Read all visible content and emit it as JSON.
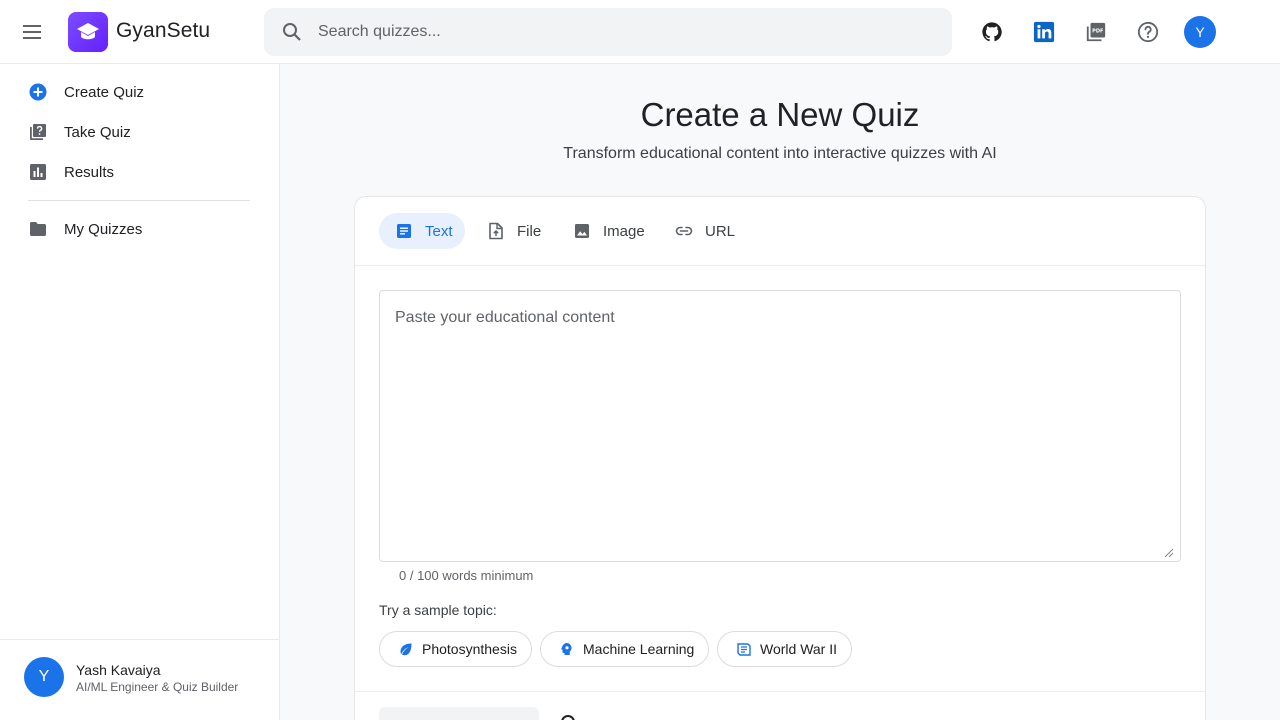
{
  "app": {
    "name": "GyanSetu",
    "colors": {
      "accent": "#1a73e8",
      "logo": "#7c4dff",
      "active_tab_bg": "#e8f0fe"
    }
  },
  "header": {
    "search_placeholder": "Search quizzes...",
    "icons": [
      "menu-icon",
      "search-icon",
      "github-icon",
      "linkedin-icon",
      "pdf-icon",
      "help-icon"
    ],
    "avatar_initial": "Y"
  },
  "sidebar": {
    "items": [
      {
        "label": "Create Quiz",
        "icon": "add-circle-icon"
      },
      {
        "label": "Take Quiz",
        "icon": "quiz-icon"
      },
      {
        "label": "Results",
        "icon": "bar-chart-icon"
      },
      {
        "label": "My Quizzes",
        "icon": "folder-icon"
      }
    ],
    "profile": {
      "initial": "Y",
      "name": "Yash Kavaiya",
      "role": "AI/ML Engineer & Quiz Builder"
    }
  },
  "main": {
    "title": "Create a New Quiz",
    "subtitle": "Transform educational content into interactive quizzes with AI",
    "tabs": [
      {
        "label": "Text",
        "icon": "article-icon",
        "active": true
      },
      {
        "label": "File",
        "icon": "upload-file-icon",
        "active": false
      },
      {
        "label": "Image",
        "icon": "image-icon",
        "active": false
      },
      {
        "label": "URL",
        "icon": "link-icon",
        "active": false
      }
    ],
    "content_placeholder": "Paste your educational content",
    "word_count": "0 / 100 words minimum",
    "sample_label": "Try a sample topic:",
    "samples": [
      {
        "label": "Photosynthesis",
        "icon": "leaf-icon"
      },
      {
        "label": "Machine Learning",
        "icon": "brain-icon"
      },
      {
        "label": "World War II",
        "icon": "history-icon"
      }
    ]
  }
}
